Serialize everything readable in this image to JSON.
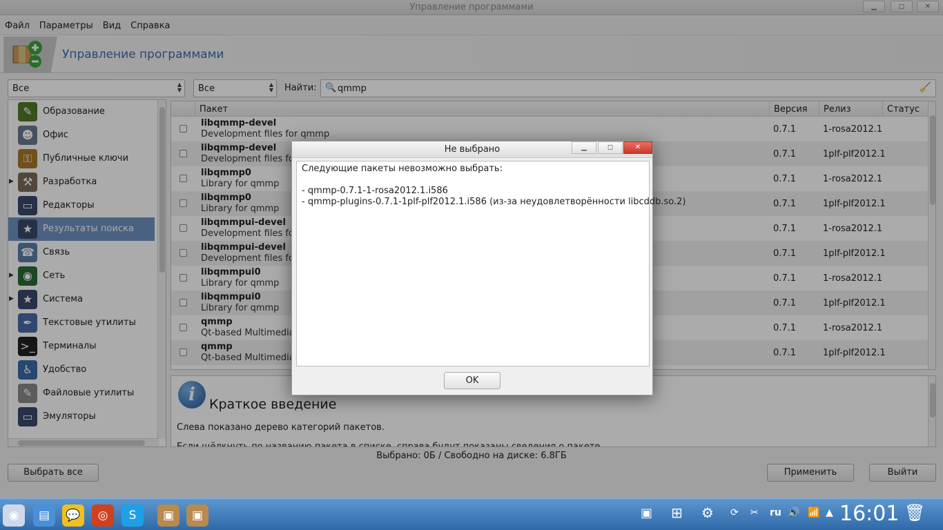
{
  "window": {
    "title": "Управление программами"
  },
  "menu": [
    "Файл",
    "Параметры",
    "Вид",
    "Справка"
  ],
  "header": {
    "title": "Управление программами"
  },
  "filters": {
    "combo1": "Все",
    "combo2": "Все",
    "find_label": "Найти:",
    "search_value": "qmmp"
  },
  "sidebar": {
    "items": [
      {
        "label": "Образование",
        "icon": "education-icon",
        "expandable": false,
        "selected": false,
        "color": "#4f7a2a",
        "glyph": "✎"
      },
      {
        "label": "Офис",
        "icon": "office-icon",
        "expandable": false,
        "selected": false,
        "color": "#6a7a8c",
        "glyph": "☻"
      },
      {
        "label": "Публичные ключи",
        "icon": "keys-icon",
        "expandable": false,
        "selected": false,
        "color": "#a87a2a",
        "glyph": "⚿"
      },
      {
        "label": "Разработка",
        "icon": "development-icon",
        "expandable": true,
        "selected": false,
        "color": "#7a6a5a",
        "glyph": "⚒"
      },
      {
        "label": "Редакторы",
        "icon": "editors-icon",
        "expandable": false,
        "selected": false,
        "color": "#3a4a6a",
        "glyph": "▭"
      },
      {
        "label": "Результаты поиска",
        "icon": "search-results-icon",
        "expandable": false,
        "selected": true,
        "color": "#3a4a6a",
        "glyph": "★"
      },
      {
        "label": "Связь",
        "icon": "communication-icon",
        "expandable": false,
        "selected": false,
        "color": "#5a7ea8",
        "glyph": "☎"
      },
      {
        "label": "Сеть",
        "icon": "network-icon",
        "expandable": true,
        "selected": false,
        "color": "#2a6a3a",
        "glyph": "◉"
      },
      {
        "label": "Система",
        "icon": "system-icon",
        "expandable": true,
        "selected": false,
        "color": "#3a4a6a",
        "glyph": "★"
      },
      {
        "label": "Текстовые утилиты",
        "icon": "text-utils-icon",
        "expandable": false,
        "selected": false,
        "color": "#4a6aa8",
        "glyph": "✒"
      },
      {
        "label": "Терминалы",
        "icon": "terminal-icon",
        "expandable": false,
        "selected": false,
        "color": "#222222",
        "glyph": ">_"
      },
      {
        "label": "Удобство",
        "icon": "accessibility-icon",
        "expandable": false,
        "selected": false,
        "color": "#3a6aa8",
        "glyph": "♿"
      },
      {
        "label": "Файловые утилиты",
        "icon": "file-utils-icon",
        "expandable": false,
        "selected": false,
        "color": "#8a8a8a",
        "glyph": "✎"
      },
      {
        "label": "Эмуляторы",
        "icon": "emulators-icon",
        "expandable": false,
        "selected": false,
        "color": "#3a4a6a",
        "glyph": "▭"
      }
    ]
  },
  "table": {
    "columns": [
      "Пакет",
      "Версия",
      "Релиз",
      "Статус"
    ],
    "rows": [
      {
        "name": "libqmmp-devel",
        "desc": "Development files for qmmp",
        "version": "0.7.1",
        "release": "1-rosa2012.1",
        "status": ""
      },
      {
        "name": "libqmmp-devel",
        "desc": "Development files for c",
        "version": "0.7.1",
        "release": "1plf-plf2012.1",
        "status": ""
      },
      {
        "name": "libqmmp0",
        "desc": "Library for qmmp",
        "version": "0.7.1",
        "release": "1-rosa2012.1",
        "status": ""
      },
      {
        "name": "libqmmp0",
        "desc": "Library for qmmp",
        "version": "0.7.1",
        "release": "1plf-plf2012.1",
        "status": ""
      },
      {
        "name": "libqmmpui-devel",
        "desc": "Development files for c",
        "version": "0.7.1",
        "release": "1-rosa2012.1",
        "status": ""
      },
      {
        "name": "libqmmpui-devel",
        "desc": "Development files for c",
        "version": "0.7.1",
        "release": "1plf-plf2012.1",
        "status": ""
      },
      {
        "name": "libqmmpui0",
        "desc": "Library for qmmp",
        "version": "0.7.1",
        "release": "1-rosa2012.1",
        "status": ""
      },
      {
        "name": "libqmmpui0",
        "desc": "Library for qmmp",
        "version": "0.7.1",
        "release": "1plf-plf2012.1",
        "status": ""
      },
      {
        "name": "qmmp",
        "desc": "Qt-based Multimedia P",
        "version": "0.7.1",
        "release": "1-rosa2012.1",
        "status": ""
      },
      {
        "name": "qmmp",
        "desc": "Qt-based Multimedia P",
        "version": "0.7.1",
        "release": "1plf-plf2012.1",
        "status": ""
      }
    ]
  },
  "description": {
    "heading": "Краткое введение",
    "line1": "Слева показано дерево категорий пакетов.",
    "line2": "Если щёлкнуть по названию пакета в списке, справа будут показаны сведения о пакете."
  },
  "status_text": "Выбрано: 0Б / Свободно на диске: 6.8ГБ",
  "buttons": {
    "select_all": "Выбрать все",
    "apply": "Применить",
    "quit": "Выйти"
  },
  "dialog": {
    "title": "Не выбрано",
    "lines": [
      "Следующие пакеты невозможно выбрать:",
      "",
      "- qmmp-0.7.1-1-rosa2012.1.i586",
      "- qmmp-plugins-0.7.1-1plf-plf2012.1.i586 (из-за неудовлетворённости libcddb.so.2)"
    ],
    "ok": "OK"
  },
  "taskbar": {
    "apps": [
      {
        "name": "rosa-menu-icon",
        "glyph": "◉",
        "color": "#cfd8e8"
      },
      {
        "name": "file-manager-icon",
        "glyph": "▤",
        "color": "#4a90d9"
      },
      {
        "name": "messenger-icon",
        "glyph": "💬",
        "color": "#f0c020"
      },
      {
        "name": "chromium-icon",
        "glyph": "◎",
        "color": "#d04020"
      },
      {
        "name": "skype-icon",
        "glyph": "S",
        "color": "#1ea0e8"
      },
      {
        "name": "package-installer-icon",
        "glyph": "▣",
        "color": "#b88a50"
      },
      {
        "name": "package-manager-icon",
        "glyph": "▣",
        "color": "#b88a50"
      }
    ],
    "tray": {
      "language": "ru",
      "time": "16:01"
    }
  }
}
